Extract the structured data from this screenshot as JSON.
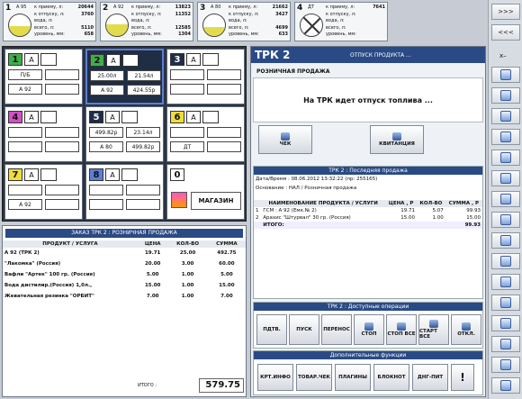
{
  "tanks": [
    {
      "num": "1",
      "name": "А 95",
      "fill": 0.45,
      "cross": false,
      "rows": [
        [
          "к приему, л:",
          "20644"
        ],
        [
          "к отпуску, л:",
          "3760"
        ],
        [
          "вода, л:",
          ""
        ],
        [
          "всего, л:",
          "5110"
        ],
        [
          "уровень, мм:",
          "658"
        ]
      ]
    },
    {
      "num": "2",
      "name": "А 92",
      "fill": 0.55,
      "cross": false,
      "rows": [
        [
          "к приему, л:",
          "13823"
        ],
        [
          "к отпуску, л:",
          "11352"
        ],
        [
          "вода, л:",
          ""
        ],
        [
          "всего, л:",
          "12585"
        ],
        [
          "уровень, мм:",
          "1304"
        ]
      ]
    },
    {
      "num": "3",
      "name": "А 80",
      "fill": 0.4,
      "cross": false,
      "rows": [
        [
          "к приему, л:",
          "21662"
        ],
        [
          "к отпуску, л:",
          "3427"
        ],
        [
          "вода, л:",
          ""
        ],
        [
          "всего, л:",
          "4699"
        ],
        [
          "уровень, мм:",
          "633"
        ]
      ]
    },
    {
      "num": "4",
      "name": "ДТ",
      "fill": 0,
      "cross": true,
      "rows": [
        [
          "к приему, л:",
          "7641"
        ],
        [
          "к отпуску, л:",
          ""
        ],
        [
          "вода, л:",
          ""
        ],
        [
          "всего, л:",
          ""
        ],
        [
          "уровень, мм:",
          ""
        ]
      ]
    }
  ],
  "toolbar": {
    "up": ">>>",
    "down": "<<<",
    "x": "x–"
  },
  "dispensers": [
    {
      "num": "1",
      "color": "#3fae49",
      "state": "А",
      "l1": "П/Б",
      "l2": "",
      "l3": "А 92",
      "l4": ""
    },
    {
      "num": "2",
      "color": "#3fae49",
      "state": "А",
      "l1": "25.00л",
      "l2": "21.54л",
      "l3": "А 92",
      "l4": "424.55р"
    },
    {
      "num": "3",
      "color": "#1f2d45",
      "state": "А",
      "l1": "",
      "l2": "",
      "l3": "",
      "l4": ""
    },
    {
      "num": "4",
      "color": "#d44ec8",
      "state": "А",
      "l1": "",
      "l2": "",
      "l3": "",
      "l4": ""
    },
    {
      "num": "5",
      "color": "#1f2d45",
      "state": "А",
      "l1": "499.82р",
      "l2": "23.14л",
      "l3": "А 80",
      "l4": "499.82р"
    },
    {
      "num": "6",
      "color": "#f0dd3a",
      "state": "А",
      "l1": "",
      "l2": "",
      "l3": "ДТ",
      "l4": ""
    },
    {
      "num": "7",
      "color": "#f0dd3a",
      "state": "А",
      "l1": "",
      "l2": "",
      "l3": "А 92",
      "l4": ""
    },
    {
      "num": "8",
      "color": "#5b7fd6",
      "state": "А",
      "l1": "",
      "l2": "",
      "l3": "",
      "l4": ""
    },
    {
      "num": "0",
      "color": "#fff",
      "state": "",
      "l1": "",
      "l2": "",
      "l3": "",
      "l4": "",
      "shop": "МАГАЗИН"
    }
  ],
  "order": {
    "title": "ЗАКАЗ ТРК 2 :  РОЗНИЧНАЯ ПРОДАЖА",
    "headers": [
      "ПРОДУКТ / УСЛУГА",
      "ЦЕНА",
      "КОЛ-ВО",
      "СУММА"
    ],
    "rows": [
      [
        "А 92 (ТРК 2)",
        "19.71",
        "25.00",
        "492.75"
      ],
      [
        "\"Лакомка\" (Россия)",
        "20.00",
        "3.00",
        "60.00"
      ],
      [
        "Вафли \"Артек\" 100 гр. (Россия)",
        "5.00",
        "1.00",
        "5.00"
      ],
      [
        "Вода  дистилир.(Россия) 1,0л.,",
        "15.00",
        "1.00",
        "15.00"
      ],
      [
        "Жевательная резинка \"ОРБИТ\"",
        "7.00",
        "1.00",
        "7.00"
      ]
    ],
    "total_label": "ИТОГО :",
    "total": "579.75"
  },
  "trk": {
    "title": "ТРК 2",
    "subtitle": "ОТПУСК ПРОДУКТА ...",
    "mode": "РОЗНИЧНАЯ ПРОДАЖА",
    "message": "На ТРК идет отпуск топлива ...",
    "check_btn": "ЧЕК",
    "receipt_btn": "КВИТАНЦИЯ"
  },
  "last_sale": {
    "title": "ТРК 2 : Последняя продажа",
    "date_label": "Дата/Время :",
    "date": "08.06.2012 13:32:22  (пр: 255165)",
    "basis_label": "Основание :",
    "basis": "НАЛ / Розничная продажа",
    "headers": [
      "НАИМЕНОВАНИЕ ПРОДУКТА / УСЛУГИ",
      "ЦЕНА , Р",
      "КОЛ-ВО",
      "СУММА , Р"
    ],
    "rows": [
      [
        "1",
        "ГСМ : А 92  (Емк.№ 2)",
        "19.71",
        "5.07",
        "99.93"
      ],
      [
        "2",
        "Арахис \"Штурвал\" 30 гр. (Россия)",
        "15.00",
        "1.00",
        "15.00"
      ]
    ],
    "total_label": "ИТОГО:",
    "total": "99.93"
  },
  "ops": {
    "title": "ТРК 2 : Доступные операции",
    "buttons": [
      "ПДТВ.",
      "ПУСК",
      "ПЕРЕНОС",
      "СТОП",
      "СТОП ВСЕ",
      "СТАРТ ВСЕ",
      "ОТКЛ."
    ]
  },
  "extra": {
    "title": "Дополнительные функции",
    "buttons": [
      "КРТ.ИНФО",
      "ТОВАР.ЧЕК",
      "ПЛАГИНЫ",
      "БЛОКНОТ",
      "ДНГ-ПИТ",
      "!"
    ]
  }
}
